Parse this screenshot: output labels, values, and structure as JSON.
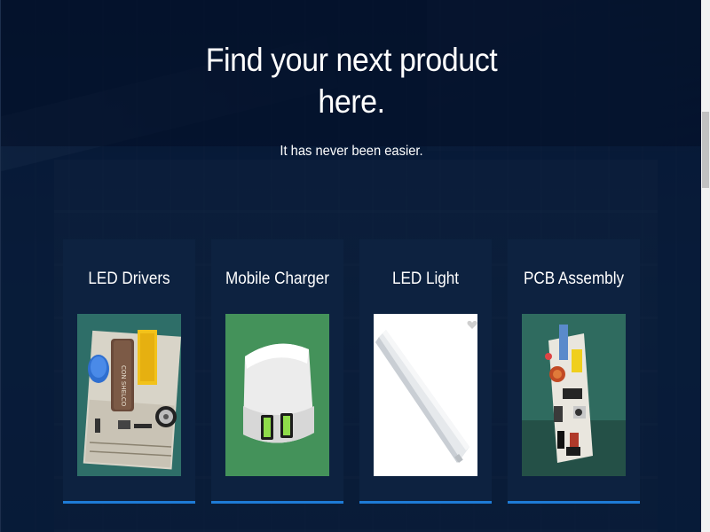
{
  "hero": {
    "title": "Find your next product here.",
    "subtitle": "It has never been easier."
  },
  "products": [
    {
      "title": "LED Drivers",
      "image_icon": "led-driver-circuit-image"
    },
    {
      "title": "Mobile Charger",
      "image_icon": "usb-charger-image"
    },
    {
      "title": "LED Light",
      "image_icon": "led-tube-light-image"
    },
    {
      "title": "PCB Assembly",
      "image_icon": "pcb-assembly-image"
    }
  ],
  "colors": {
    "header_background": "#03122b",
    "card_background": "#0d2240",
    "accent_border": "#1e7bd6",
    "text": "#ffffff"
  }
}
